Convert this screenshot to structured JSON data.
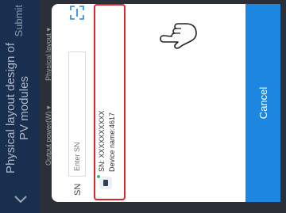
{
  "header": {
    "title": "Physical layout design of PV modules",
    "submit_label": "Submit"
  },
  "page": {
    "output_power_label": "Output power(W) ▾",
    "physical_layout_label": "Physical layout ▾"
  },
  "dialog": {
    "sn_label": "SN",
    "sn_placeholder": "Enter SN",
    "scan_icon": "scan-icon",
    "device": {
      "sn": "SN: XXXXXXXXXX",
      "name": "Device name:4617",
      "status_color": "#28c66e"
    },
    "cancel_label": "Cancel"
  },
  "colors": {
    "accent": "#1d86e1",
    "highlight": "#d9262a",
    "header": "#192f4f"
  },
  "icons": [
    "chevron-back-icon",
    "scan-icon",
    "device-icon",
    "pointing-hand-icon"
  ]
}
